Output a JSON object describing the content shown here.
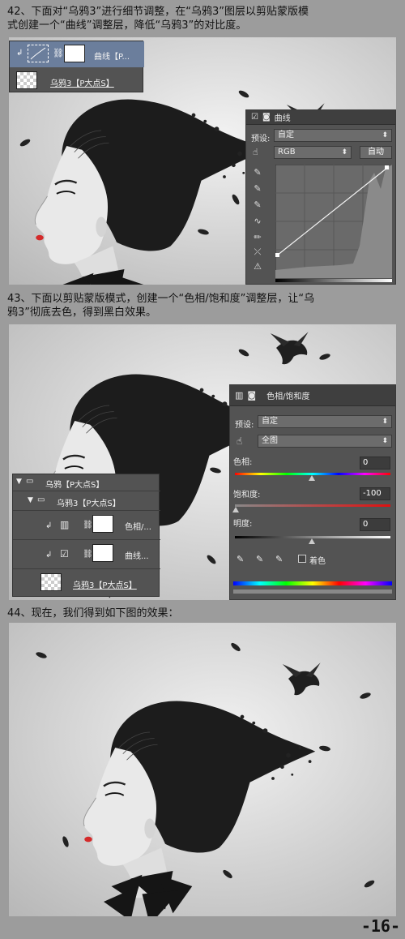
{
  "step42": {
    "caption_line1": "42、下面对“乌鸦3”进行细节调整，在“乌鸦3”图层以剪贴蒙版模",
    "caption_line2": "式创建一个“曲线”调整层，降低“乌鸦3”的对比度。",
    "layers": {
      "adjust_name": "曲线【P...",
      "base_name": "乌鸦3【P大点S】"
    },
    "curves_panel": {
      "title": "曲线",
      "preset_label": "预设:",
      "preset_value": "自定",
      "channel_value": "RGB",
      "auto_button": "自动"
    }
  },
  "step43": {
    "caption_line1": "43、下面以剪贴蒙版模式，创建一个“色相/饱和度”调整层，让“乌",
    "caption_line2": "鸦3”彻底去色，得到黑白效果。",
    "hue_panel": {
      "title": "色相/饱和度",
      "preset_label": "预设:",
      "preset_value": "自定",
      "range_value": "全图",
      "hue_label": "色相:",
      "hue_value": "0",
      "sat_label": "饱和度:",
      "sat_value": "-100",
      "light_label": "明度:",
      "light_value": "0",
      "colorize_label": "着色"
    },
    "layers": {
      "group1": "乌鸦【P大点S】",
      "group2": "乌鸦3【P大点S】",
      "layer_hue": "色相/...",
      "layer_curve": "曲线...",
      "layer_base": "乌鸦3【P大点S】"
    }
  },
  "step44": {
    "caption": "44、现在，我们得到如下图的效果："
  },
  "page_number": "-16-",
  "colors": {
    "page_bg": "#9c9c9c",
    "panel_bg": "#535353",
    "panel_dark": "#3f3f3f",
    "lips": "#d42a2a"
  },
  "icons": [
    "link-icon",
    "folder-icon",
    "triangle-down-icon",
    "eyedropper-icon",
    "curve-tool-icon",
    "pencil-icon",
    "hand-icon",
    "warning-icon",
    "clip-arrow-icon"
  ]
}
